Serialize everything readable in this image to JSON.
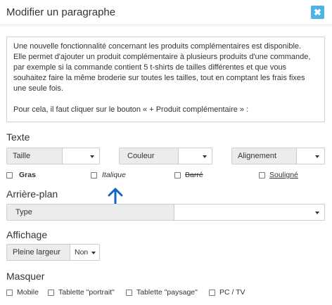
{
  "dialog": {
    "title": "Modifier un paragraphe",
    "close_glyph": "✖"
  },
  "preview": {
    "lines": [
      "Une nouvelle fonctionnalité concernant les produits complémentaires est disponible.",
      "Elle permet d'ajouter un produit complémentaire à plusieurs produits d'une commande,",
      "par exemple si la commande contient 5 t-shirts de tailles différentes et que vous",
      "souhaitez faire la même broderie sur toutes les tailles, tout en comptant les frais fixes",
      "une seule fois."
    ],
    "line2": "Pour cela, il faut cliquer sur le bouton « + Produit complémentaire » :"
  },
  "texte": {
    "heading": "Texte",
    "taille_label": "Taille",
    "couleur_label": "Couleur",
    "alignement_label": "Alignement",
    "gras": "Gras",
    "italique": "Italique",
    "barre": "Barré",
    "souligne": "Souligné"
  },
  "arriere_plan": {
    "heading": "Arrière-plan",
    "type_label": "Type"
  },
  "affichage": {
    "heading": "Affichage",
    "pleine_largeur_label": "Pleine largeur",
    "pleine_largeur_value": "Non"
  },
  "masquer": {
    "heading": "Masquer",
    "mobile": "Mobile",
    "tablette_portrait": "Tablette \"portrait\"",
    "tablette_paysage": "Tablette \"paysage\"",
    "pc_tv": "PC / TV"
  },
  "colors": {
    "accent": "#4fb3e6",
    "arrow": "#1565c0",
    "label_bg": "#ececec"
  },
  "icons": {
    "close": "close-icon",
    "caret": "caret-down-icon",
    "annotation": "arrow-up-icon"
  }
}
